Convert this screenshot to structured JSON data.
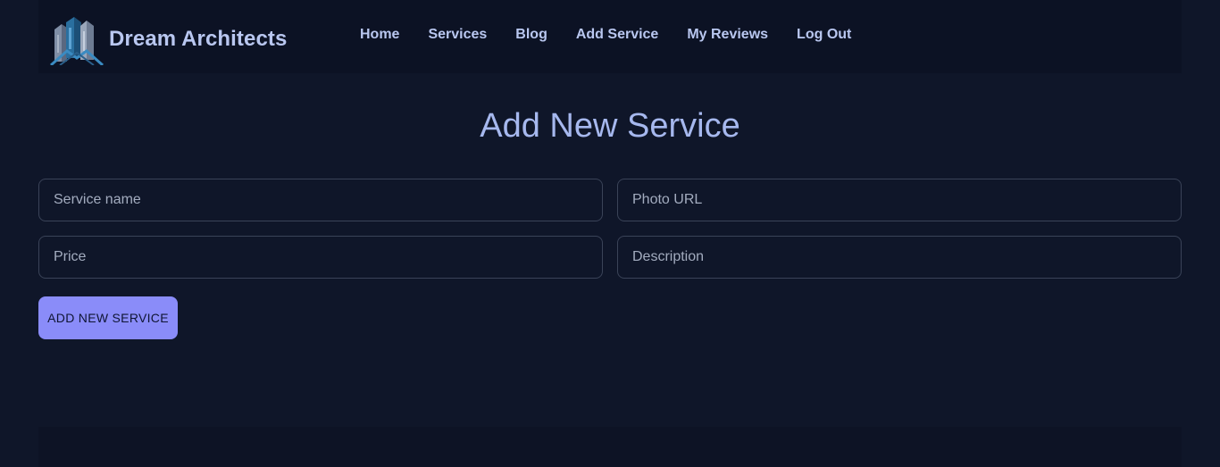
{
  "brand": {
    "name": "Dream Architects",
    "logo_icon": "building-logo-icon"
  },
  "nav": {
    "items": [
      {
        "label": "Home"
      },
      {
        "label": "Services"
      },
      {
        "label": "Blog"
      },
      {
        "label": "Add Service"
      },
      {
        "label": "My Reviews"
      },
      {
        "label": "Log Out"
      }
    ]
  },
  "page": {
    "title": "Add New Service"
  },
  "form": {
    "service_name": {
      "placeholder": "Service name",
      "value": ""
    },
    "photo_url": {
      "placeholder": "Photo URL",
      "value": ""
    },
    "price": {
      "placeholder": "Price",
      "value": ""
    },
    "description": {
      "placeholder": "Description",
      "value": ""
    },
    "submit_label": "ADD NEW SERVICE"
  },
  "colors": {
    "background": "#0f1629",
    "navbar": "#0c1224",
    "text_accent": "#b9c7f0",
    "button": "#8a8cf9"
  }
}
